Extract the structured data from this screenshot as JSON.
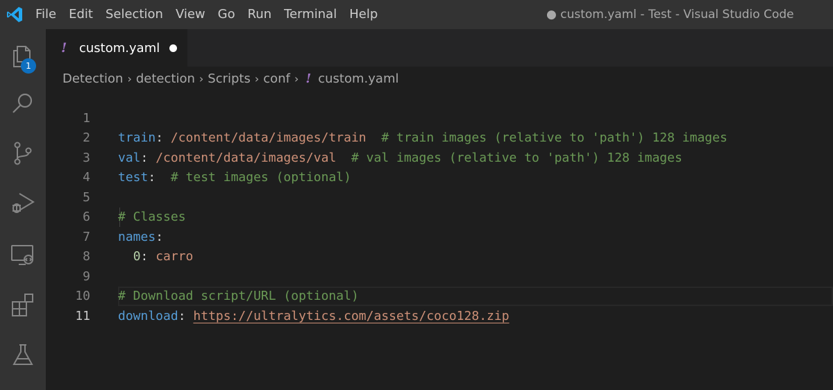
{
  "window_title": "● custom.yaml - Test - Visual Studio Code",
  "menu": [
    "File",
    "Edit",
    "Selection",
    "View",
    "Go",
    "Run",
    "Terminal",
    "Help"
  ],
  "activity": {
    "explorer_badge": "1",
    "icons": [
      "files-icon",
      "search-icon",
      "source-control-icon",
      "run-debug-icon",
      "remote-explorer-icon",
      "extensions-icon",
      "testing-icon"
    ]
  },
  "tab": {
    "icon_glyph": "!",
    "label": "custom.yaml"
  },
  "breadcrumbs": [
    "Detection",
    "detection",
    "Scripts",
    "conf"
  ],
  "breadcrumb_file": {
    "icon_glyph": "!",
    "label": "custom.yaml"
  },
  "colors": {
    "accent": "#0e70c0",
    "yaml_icon": "#a074c4",
    "key": "#569cd6",
    "string": "#ce9178",
    "comment": "#6a9955",
    "number": "#b5cea8"
  },
  "editor": {
    "lines": [
      {
        "n": "1",
        "key": "train",
        "colon": ":",
        "val": " /content/data/images/train",
        "cmt": "  # train images (relative to 'path') 128 images"
      },
      {
        "n": "2",
        "key": "val",
        "colon": ":",
        "val": " /content/data/images/val",
        "cmt": "  # val images (relative to 'path') 128 images"
      },
      {
        "n": "3",
        "key": "test",
        "colon": ":",
        "val": "",
        "cmt": "  # test images (optional)"
      },
      {
        "n": "4"
      },
      {
        "n": "5",
        "cmt": "# Classes"
      },
      {
        "n": "6",
        "key": "names",
        "colon": ":"
      },
      {
        "n": "7",
        "indent": "  ",
        "numkey": "0",
        "colon": ":",
        "val": " carro"
      },
      {
        "n": "8"
      },
      {
        "n": "9",
        "cmt": "# Download script/URL (optional)"
      },
      {
        "n": "10",
        "key": "download",
        "colon": ": ",
        "link": "https://ultralytics.com/assets/coco128.zip"
      },
      {
        "n": "11"
      }
    ]
  }
}
